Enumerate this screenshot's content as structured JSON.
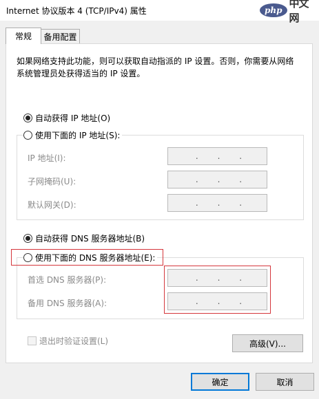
{
  "window": {
    "title": "Internet 协议版本 4 (TCP/IPv4) 属性",
    "watermark": {
      "logo": "php",
      "text": "中文网"
    }
  },
  "tabs": [
    {
      "label": "常规",
      "active": true
    },
    {
      "label": "备用配置",
      "active": false
    }
  ],
  "description": "如果网络支持此功能，则可以获取自动指派的 IP 设置。否则，你需要从网络系统管理员处获得适当的 IP 设置。",
  "ip": {
    "auto_label": "自动获得 IP 地址(O)",
    "manual_label": "使用下面的 IP 地址(S):",
    "selected": "auto",
    "fields": [
      {
        "label": "IP 地址(I):",
        "value": ". . ."
      },
      {
        "label": "子网掩码(U):",
        "value": ". . ."
      },
      {
        "label": "默认网关(D):",
        "value": ". . ."
      }
    ]
  },
  "dns": {
    "auto_label": "自动获得 DNS 服务器地址(B)",
    "manual_label": "使用下面的 DNS 服务器地址(E):",
    "selected": "auto",
    "fields": [
      {
        "label": "首选 DNS 服务器(P):",
        "value": ". . ."
      },
      {
        "label": "备用 DNS 服务器(A):",
        "value": ". . ."
      }
    ]
  },
  "validate_label": "退出时验证设置(L)",
  "advanced_label": "高级(V)...",
  "ok_label": "确定",
  "cancel_label": "取消",
  "colors": {
    "highlight": "#d4353a",
    "accent": "#0078d7"
  }
}
